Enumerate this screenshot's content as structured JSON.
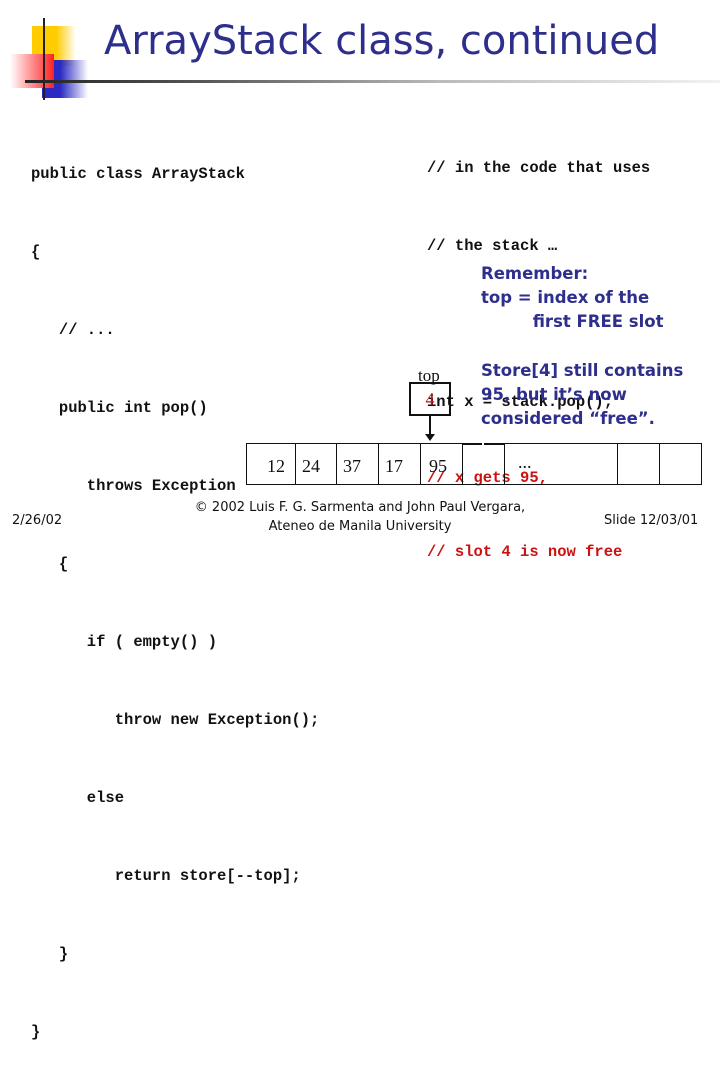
{
  "slide": {
    "title": "ArrayStack class, continued",
    "code_left": [
      "public class ArrayStack",
      "{",
      "   // ...",
      "   public int pop()",
      "      throws Exception",
      "   {",
      "      if ( empty() )",
      "         throw new Exception();",
      "      else",
      "         return store[--top];",
      "   }",
      "}"
    ],
    "code_right": [
      {
        "text": "// in the code that uses",
        "color": "black"
      },
      {
        "text": "// the stack …",
        "color": "black"
      },
      {
        "text": "",
        "color": "black"
      },
      {
        "text": "int x = stack.pop();",
        "color": "black"
      },
      {
        "text": "// x gets 95,",
        "color": "red"
      },
      {
        "text": "// slot 4 is now free",
        "color": "red"
      }
    ],
    "remember_note": "Remember:\ntop = index of the\n         first FREE slot",
    "store_note": "Store[4] still contains\n95, but it’s now\nconsidered “free”.",
    "top_pointer": {
      "label": "top",
      "value": "4"
    },
    "array_cells": [
      "12",
      "24",
      "37",
      "17",
      "95",
      "",
      "...",
      "",
      ""
    ],
    "colors": {
      "title": "#2e2e8c",
      "note": "#2e2e8c",
      "highlight": "#cc1111",
      "text": "#111111"
    }
  },
  "footer": {
    "date": "2/26/02",
    "copyright_line1": "© 2002 Luis F. G. Sarmenta and John Paul Vergara,",
    "copyright_line2": "Ateneo de Manila University",
    "slide_number": "Slide 12/03/01"
  }
}
